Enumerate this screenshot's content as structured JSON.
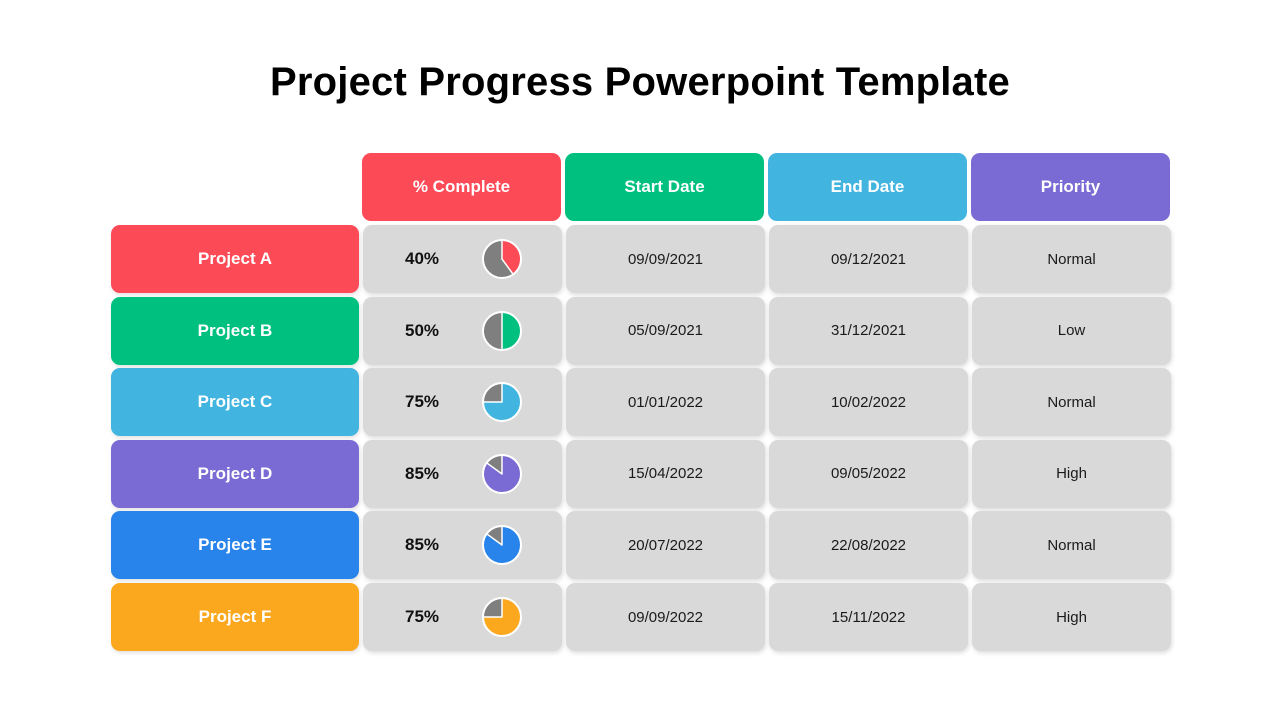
{
  "title": "Project Progress Powerpoint Template",
  "colors": {
    "cell_bg": "#d9d9d9",
    "pie_remaining": "#7f7f7f",
    "pie_border": "#ffffff"
  },
  "headers": [
    {
      "label": "% Complete",
      "color": "#fd4a57"
    },
    {
      "label": "Start Date",
      "color": "#00c080"
    },
    {
      "label": "End Date",
      "color": "#41b4e0"
    },
    {
      "label": "Priority",
      "color": "#7a6ad4"
    }
  ],
  "rows": [
    {
      "project": "Project A",
      "color": "#fd4a57",
      "percent_label": "40%",
      "percent": 40,
      "start": "09/09/2021",
      "end": "09/12/2021",
      "priority": "Normal"
    },
    {
      "project": "Project B",
      "color": "#00c080",
      "percent_label": "50%",
      "percent": 50,
      "start": "05/09/2021",
      "end": "31/12/2021",
      "priority": "Low"
    },
    {
      "project": "Project C",
      "color": "#41b4e0",
      "percent_label": "75%",
      "percent": 75,
      "start": "01/01/2022",
      "end": "10/02/2022",
      "priority": "Normal"
    },
    {
      "project": "Project D",
      "color": "#7a6ad4",
      "percent_label": "85%",
      "percent": 85,
      "start": "15/04/2022",
      "end": "09/05/2022",
      "priority": "High"
    },
    {
      "project": "Project E",
      "color": "#2884ea",
      "percent_label": "85%",
      "percent": 85,
      "start": "20/07/2022",
      "end": "22/08/2022",
      "priority": "Normal"
    },
    {
      "project": "Project F",
      "color": "#fba81f",
      "percent_label": "75%",
      "percent": 75,
      "start": "09/09/2022",
      "end": "15/11/2022",
      "priority": "High"
    }
  ]
}
